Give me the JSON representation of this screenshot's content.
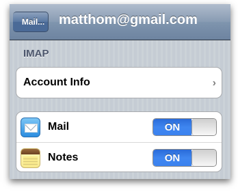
{
  "navbar": {
    "back_label": "Mail...",
    "title": "matthom@gmail.com"
  },
  "section": {
    "header": "IMAP"
  },
  "account": {
    "label": "Account Info",
    "chevron": "›"
  },
  "apps": [
    {
      "label": "Mail",
      "icon": "mail-icon",
      "toggle_label": "ON",
      "enabled": true
    },
    {
      "label": "Notes",
      "icon": "notes-icon",
      "toggle_label": "ON",
      "enabled": true
    }
  ],
  "colors": {
    "navbar": "#889bb3",
    "toggle_on": "#3b82ef",
    "background": "#c5ccd4"
  }
}
